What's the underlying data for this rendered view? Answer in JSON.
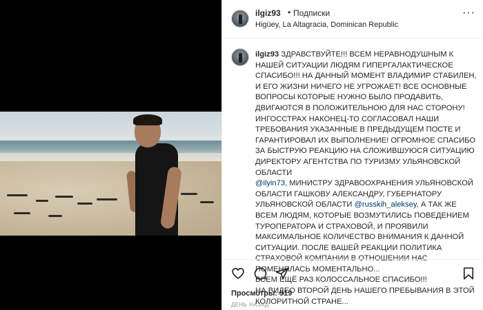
{
  "post": {
    "username": "ilgiz93",
    "separator": "•",
    "follow_label": "Подписки",
    "location": "Higüey, La Altagracia, Dominican Republic",
    "more_icon": "more-horizontal-icon"
  },
  "caption": {
    "username": "ilgiz93",
    "part1": "ЗДРАВСТВУЙТЕ!!! ВСЕМ НЕРАВНОДУШНЫМ К НАШЕЙ СИТУАЦИИ ЛЮДЯМ ГИПЕРГАЛАКТИЧЕСКОЕ СПАСИБО!!! НА ДАННЫЙ МОМЕНТ ВЛАДИМИР СТАБИЛЕН, И ЕГО ЖИЗНИ НИЧЕГО НЕ УГРОЖАЕТ! ВСЕ ОСНОВНЫЕ ВОПРОСЫ КОТОРЫЕ НУЖНО БЫЛО ПРОДАВИТЬ, ДВИГАЮТСЯ В ПОЛОЖИТЕЛЬНОЮ ДЛЯ НАС СТОРОНУ! ИНГОССТРАХ НАКОНЕЦ-ТО СОГЛАСОВАЛ НАШИ ТРЕБОВАНИЯ УКАЗАННЫЕ В ПРЕДЫДУЩЕМ ПОСТЕ И ГАРАНТИРОВАЛ ИХ ВЫПОЛНЕНИЕ! ОГРОМНОЕ СПАСИБО ЗА БЫСТРУЮ РЕАКЦИЮ НА СЛОЖИВШУЮСЯ СИТУАЦИЮ ДИРЕКТОРУ АГЕНТСТВА ПО ТУРИЗМУ УЛЬЯНОВСКОЙ ОБЛАСТИ",
    "mention1": "@ilyin73",
    "part2": ", МИНИСТРУ ЗДРАВООХРАНЕНИЯ УЛЬЯНОВСКОЙ ОБЛАСТИ ГАШКОВУ АЛЕКСАНДРУ, ГУБЕРНАТОРУ УЛЬЯНОВСКОЙ ОБЛАСТИ",
    "mention2": "@russkih_aleksey",
    "part3": ", А ТАК ЖЕ ВСЕМ ЛЮДЯМ, КОТОРЫЕ ВОЗМУТИЛИСЬ ПОВЕДЕНИЕМ ТУРОПЕРАТОРА И СТРАХОВОЙ, И ПРОЯВИЛИ МАКСИМАЛЬНОЕ КОЛИЧЕСТВО ВНИМАНИЯ К ДАННОЙ СИТУАЦИИ. ПОСЛЕ ВАШЕЙ РЕАКЦИИ ПОЛИТИКА СТРАХОВОЙ КОМПАНИИ В ОТНОШЕНИИ НАС ПОМЕНЯЛАСЬ МОМЕНТАЛЬНО...",
    "line2": "ВСЕМ ЕЩЁ РАЗ КОЛОССАЛЬНОЕ СПАСИБО!!!",
    "line3": "НА ВИДЕО ВТОРОЙ ДЕНЬ НАШЕГО ПРЕБЫВАНИЯ В ЭТОЙ КОЛОРИТНОЙ СТРАНЕ..."
  },
  "actions": {
    "like_icon": "heart-icon",
    "comment_icon": "comment-icon",
    "share_icon": "send-icon",
    "save_icon": "bookmark-icon"
  },
  "stats": {
    "views_label": "Просмотры:",
    "views_count": "919",
    "timestamp": "ДЕНЬ НАЗАД"
  }
}
